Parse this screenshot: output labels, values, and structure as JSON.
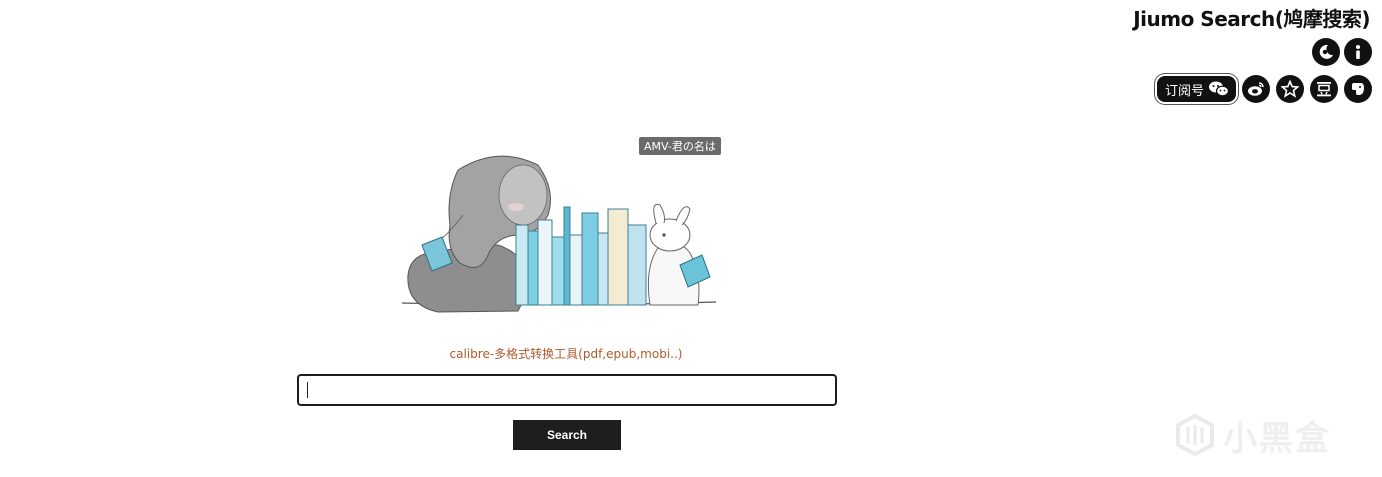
{
  "header": {
    "brand": "Jiumo Search(鸠摩搜索)",
    "icons_row1": [
      {
        "name": "theme-toggle",
        "icon": "moon-icon"
      },
      {
        "name": "info",
        "icon": "info-icon"
      }
    ],
    "subscribe_label": "订阅号",
    "icons_row2": [
      {
        "name": "weibo",
        "icon": "weibo-icon"
      },
      {
        "name": "favorite",
        "icon": "star-icon"
      },
      {
        "name": "douban",
        "icon": "douban-icon"
      },
      {
        "name": "evernote",
        "icon": "elephant-icon"
      }
    ]
  },
  "hero": {
    "badge": "AMV-君の名は"
  },
  "promo": {
    "link_text": "calibre-多格式转换工具(pdf,epub,mobi..)"
  },
  "search": {
    "value": "",
    "placeholder": "",
    "button_label": "Search"
  },
  "watermark": {
    "text": "小黑盒"
  },
  "colors": {
    "accent": "#a0522d",
    "button_bg": "#1e1e1e",
    "icon_bg": "#111111"
  }
}
